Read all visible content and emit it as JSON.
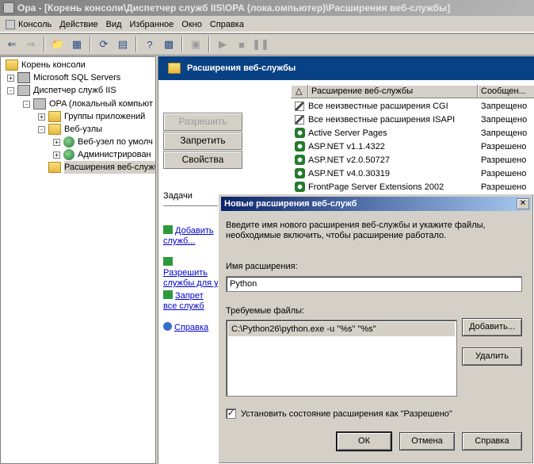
{
  "window": {
    "title": "Opa - [Корень консоли\\Диспетчер служб IIS\\OPA (лока.омпьютер)\\Расширения веб-службы]"
  },
  "menu": {
    "items": [
      "Консоль",
      "Действие",
      "Вид",
      "Избранное",
      "Окно",
      "Справка"
    ]
  },
  "tree": {
    "root": "Корень консоли",
    "sql": "Microsoft SQL Servers",
    "iis": "Диспетчер служб IIS",
    "server": "OPA (локальный компьют",
    "apppools": "Группы приложений",
    "websites": "Веб-узлы",
    "defaultsite": "Веб-узел по умолч",
    "admin": "Администрирован",
    "extensions": "Расширения веб-служб"
  },
  "rightpane": {
    "header": "Расширения веб-службы",
    "allow_button": "Разрешить",
    "deny_button": "Запретить",
    "properties_button": "Свойства",
    "tasks_title": "Задачи",
    "task1": "Добавить служб...",
    "task2": "Разрешить службы для у",
    "task3": "Запрет все служб",
    "help": "Справка"
  },
  "listview": {
    "col_name": "Расширение веб-службы",
    "col_status": "Сообщен...",
    "rows": [
      {
        "name": "Все неизвестные расширения CGI",
        "status": "Запрещено",
        "icon": "filter-icon"
      },
      {
        "name": "Все неизвестные расширения ISAPI",
        "status": "Запрещено",
        "icon": "filter-icon"
      },
      {
        "name": "Active Server Pages",
        "status": "Запрещено",
        "icon": "gear-icon"
      },
      {
        "name": "ASP.NET v1.1.4322",
        "status": "Разрешено",
        "icon": "gear-icon"
      },
      {
        "name": "ASP.NET v2.0.50727",
        "status": "Разрешено",
        "icon": "gear-icon"
      },
      {
        "name": "ASP.NET v4.0.30319",
        "status": "Разрешено",
        "icon": "gear-icon"
      },
      {
        "name": "FrontPage Server Extensions 2002",
        "status": "Разрешено",
        "icon": "gear-icon"
      }
    ]
  },
  "dialog": {
    "title": "Новые расширения веб-служб",
    "description": "Введите имя нового расширения веб-службы и укажите файлы, необходимые включить, чтобы расширение работало.",
    "name_label": "Имя расширения:",
    "name_value": "Python",
    "files_label": "Требуемые файлы:",
    "file_item": "C:\\Python26\\python.exe -u \"%s\" \"%s\"",
    "add_button": "Добавить...",
    "remove_button": "Удалить",
    "checkbox_label": "Установить состояние расширения как \"Разрешено\"",
    "checkbox_checked": true,
    "ok_button": "ОК",
    "cancel_button": "Отмена",
    "help_button": "Справка"
  }
}
